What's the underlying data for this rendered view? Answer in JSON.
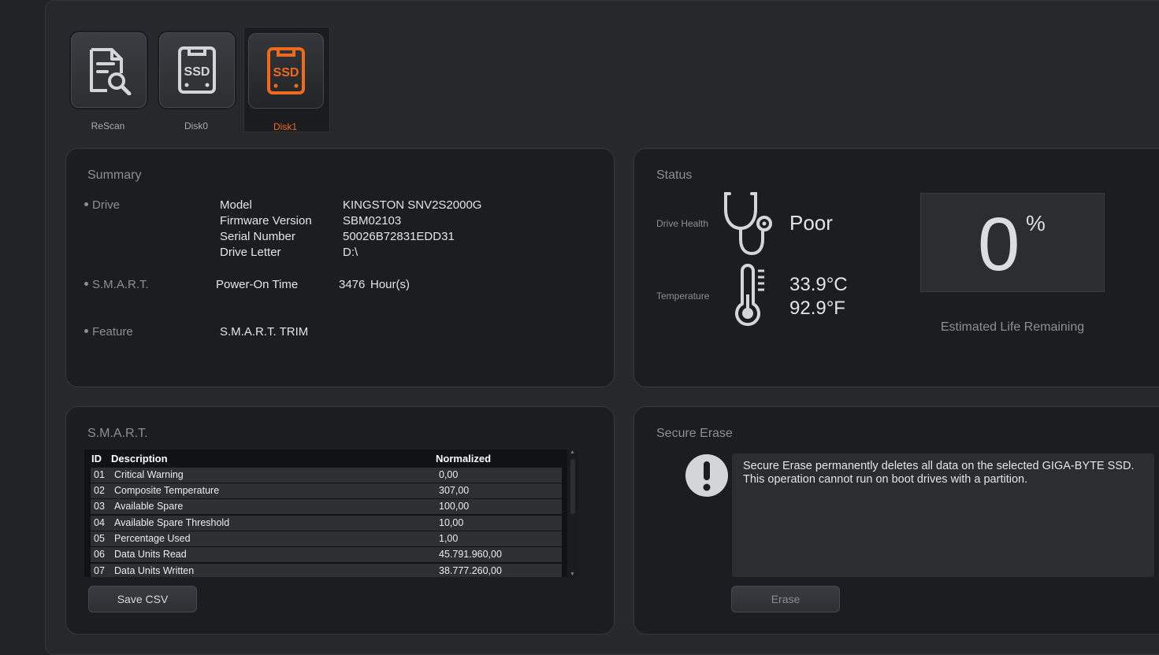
{
  "toolbar": {
    "rescan": "ReScan",
    "disk0": "Disk0",
    "disk1": "Disk1",
    "disk_icon_text": "SSD"
  },
  "summary": {
    "title": "Summary",
    "drive_label": "Drive",
    "smart_label": "S.M.A.R.T.",
    "feature_label": "Feature",
    "model_label": "Model",
    "model_value": "KINGSTON SNV2S2000G",
    "firmware_label": "Firmware Version",
    "firmware_value": "SBM02103",
    "serial_label": "Serial Number",
    "serial_value": "50026B72831EDD31",
    "letter_label": "Drive Letter",
    "letter_value": "D:\\",
    "poweron_label": "Power-On Time",
    "poweron_value": "3476",
    "poweron_unit": "Hour(s)",
    "feature_value": "S.M.A.R.T. TRIM"
  },
  "status": {
    "title": "Status",
    "health_label": "Drive Health",
    "health_value": "Poor",
    "temp_label": "Temperature",
    "temp_c": "33.9°C",
    "temp_f": "92.9°F",
    "life_value": "0",
    "life_unit": "%",
    "life_label": "Estimated Life Remaining"
  },
  "smart": {
    "title": "S.M.A.R.T.",
    "col_id": "ID",
    "col_desc": "Description",
    "col_norm": "Normalized",
    "rows": [
      {
        "id": "01",
        "desc": "Critical Warning",
        "norm": "0,00"
      },
      {
        "id": "02",
        "desc": "Composite Temperature",
        "norm": "307,00"
      },
      {
        "id": "03",
        "desc": "Available Spare",
        "norm": "100,00"
      },
      {
        "id": "04",
        "desc": "Available Spare Threshold",
        "norm": "10,00"
      },
      {
        "id": "05",
        "desc": "Percentage Used",
        "norm": "1,00"
      },
      {
        "id": "06",
        "desc": "Data Units Read",
        "norm": "45.791.960,00"
      },
      {
        "id": "07",
        "desc": "Data Units Written",
        "norm": "38.777.260,00"
      }
    ],
    "save_button": "Save CSV"
  },
  "erase": {
    "title": "Secure Erase",
    "message": "Secure Erase permanently deletes all data on the selected GIGA-BYTE SSD. This operation cannot run on boot drives with a partition.",
    "button": "Erase"
  },
  "colors": {
    "accent": "#ee6a1d",
    "icon_gray": "#d4d5d7"
  }
}
